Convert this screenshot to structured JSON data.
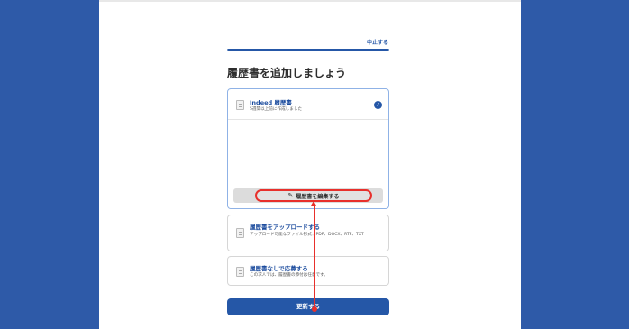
{
  "header": {
    "cancel_label": "中止する"
  },
  "page": {
    "heading": "履歴書を追加しましょう"
  },
  "resume_indeed": {
    "title": "Indeed 履歴書",
    "subtitle": "5週間以上前に作成しました",
    "edit_label": "履歴書を編集する"
  },
  "resume_upload": {
    "title": "履歴書をアップロードする",
    "subtitle": "アップロード可能なファイル形式：PDF、DOCX、RTF、TXT"
  },
  "resume_none": {
    "title": "履歴書なしで応募する",
    "subtitle": "この求人では、履歴書の添付は任意です。"
  },
  "footer": {
    "update_label": "更新する"
  },
  "colors": {
    "brand": "#2557a7",
    "annotation": "#e8302c",
    "background": "#2e5aa8"
  },
  "icons": [
    "document-icon",
    "check-circle-icon",
    "pencil-icon",
    "upload-document-icon",
    "no-document-icon"
  ]
}
